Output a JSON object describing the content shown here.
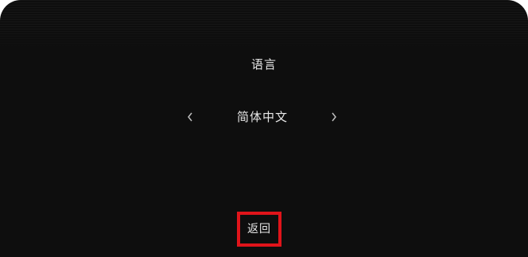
{
  "settings": {
    "title": "语言",
    "language_selector": {
      "selected": "简体中文",
      "prev_icon": "chevron-left-icon",
      "next_icon": "chevron-right-icon"
    },
    "back_label": "返回"
  },
  "colors": {
    "background": "#0e0e0e",
    "text": "#e8e8e8",
    "highlight_border": "#e0141a"
  }
}
